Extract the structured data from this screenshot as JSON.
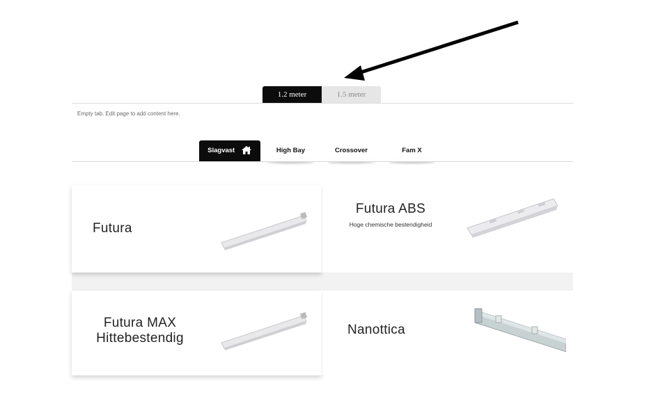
{
  "top_tabs": [
    {
      "label": "1.2 meter",
      "active": true
    },
    {
      "label": "1.5 meter",
      "active": false
    }
  ],
  "empty_note": "Empty tab. Edit page to add content here.",
  "category_tabs": [
    {
      "label": "Slagvast",
      "active": true,
      "icon": "home-icon"
    },
    {
      "label": "High Bay",
      "active": false
    },
    {
      "label": "Crossover",
      "active": false
    },
    {
      "label": "Fam X",
      "active": false
    }
  ],
  "products": [
    {
      "title": "Futura",
      "subtitle": ""
    },
    {
      "title": "Futura ABS",
      "subtitle": "Hoge chemische bestendigheid"
    },
    {
      "title_line1": "Futura MAX",
      "title_line2": "Hittebestendig"
    },
    {
      "title": "Nanottica"
    }
  ],
  "colors": {
    "tab_active_bg": "#0c0c0c",
    "tab_inactive_bg": "#e6e6e6",
    "arrow": "#000000"
  }
}
